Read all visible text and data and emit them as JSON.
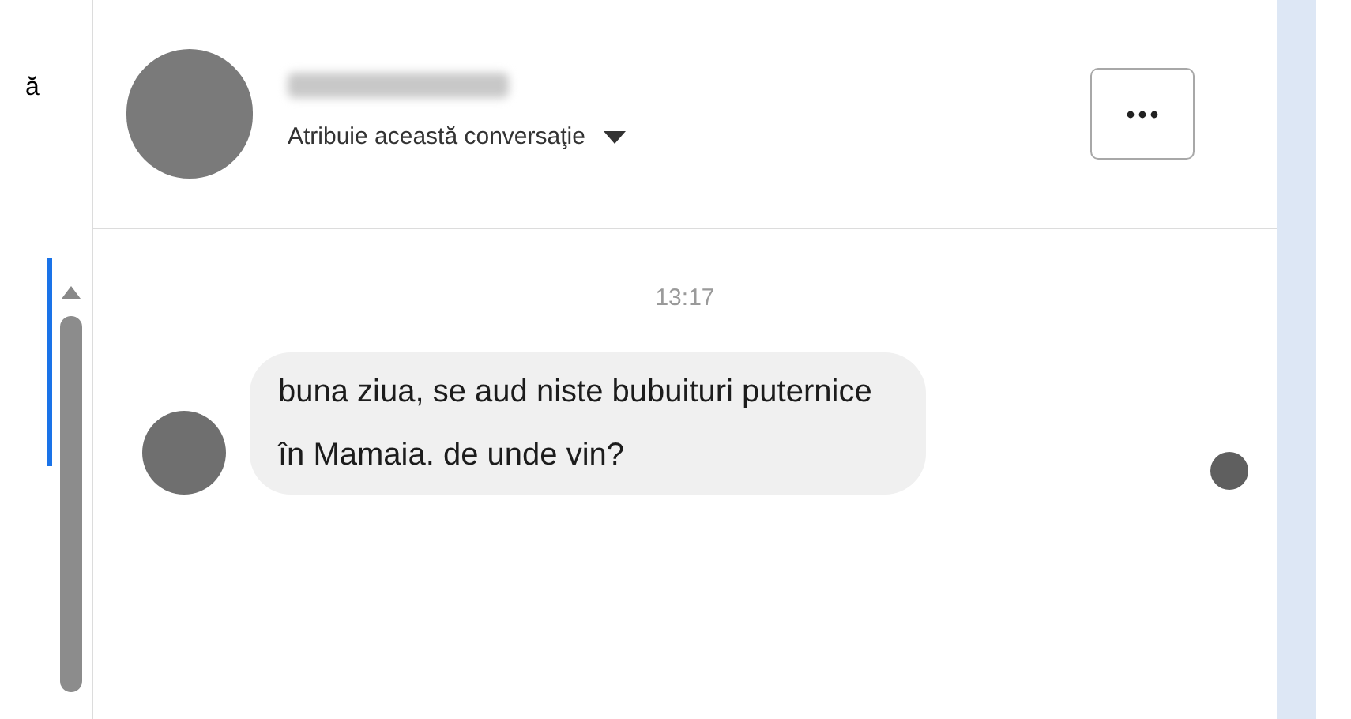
{
  "sidebar_fragment": "ă",
  "header": {
    "assign_label": "Atribuie această conversaţie"
  },
  "messages": [
    {
      "time": "13:17",
      "text": "buna ziua, se aud niste bubuituri puternice în Mamaia. de unde vin?",
      "seen": true
    }
  ]
}
